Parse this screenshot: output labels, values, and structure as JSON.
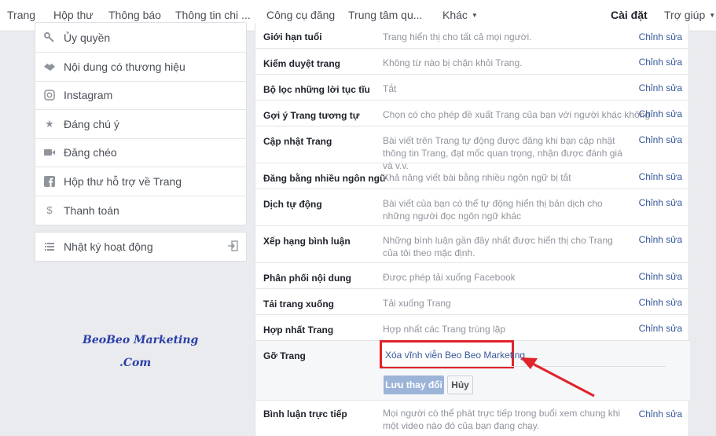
{
  "topnav": {
    "items": [
      "Trang",
      "Hộp thư",
      "Thông báo",
      "Thông tin chi ...",
      "Công cụ đăng",
      "Trung tâm qu...",
      "Khác"
    ],
    "settings": "Cài đặt",
    "help": "Trợ giúp"
  },
  "sidebar": {
    "items": [
      {
        "label": "Ủy quyền",
        "icon": "key-icon"
      },
      {
        "label": "Nội dung có thương hiệu",
        "icon": "handshake-icon"
      },
      {
        "label": "Instagram",
        "icon": "instagram-icon"
      },
      {
        "label": "Đáng chú ý",
        "icon": "star-icon"
      },
      {
        "label": "Đăng chéo",
        "icon": "video-camera-icon"
      },
      {
        "label": "Hộp thư hỗ trợ về Trang",
        "icon": "facebook-icon"
      },
      {
        "label": "Thanh toán",
        "icon": "dollar-icon"
      }
    ],
    "log": {
      "label": "Nhật ký hoạt động",
      "icon": "list-icon"
    }
  },
  "watermark": {
    "line1": "BeoBeo Marketing",
    "line2": ".Com"
  },
  "settings": {
    "rows": [
      {
        "name": "Giới hạn tuổi",
        "desc": "Trang hiển thị cho tất cả mọi người.",
        "edit": "Chỉnh sửa"
      },
      {
        "name": "Kiểm duyệt trang",
        "desc": "Không từ nào bị chặn khỏi Trang.",
        "edit": "Chỉnh sửa"
      },
      {
        "name": "Bộ lọc những lời tục tĩu",
        "desc": "Tắt",
        "edit": "Chỉnh sửa"
      },
      {
        "name": "Gợi ý Trang tương tự",
        "desc": "Chọn có cho phép đề xuất Trang của bạn với người khác không",
        "edit": "Chỉnh sửa"
      },
      {
        "name": "Cập nhật Trang",
        "desc": "Bài viết trên Trang tự động được đăng khi bạn cập nhật thông tin Trang, đạt mốc quan trọng, nhận được đánh giá và v.v.",
        "edit": "Chỉnh sửa"
      },
      {
        "name": "Đăng bằng nhiều ngôn ngữ",
        "desc": "Khả năng viết bài bằng nhiều ngôn ngữ bị tắt",
        "edit": "Chỉnh sửa"
      },
      {
        "name": "Dịch tự động",
        "desc": "Bài viết của bạn có thể tự động hiển thị bản dịch cho những người đọc ngôn ngữ khác",
        "edit": "Chỉnh sửa"
      },
      {
        "name": "Xếp hạng bình luận",
        "desc": "Những bình luận gần đây nhất được hiển thị cho Trang của tôi theo mặc định.",
        "edit": "Chỉnh sửa"
      },
      {
        "name": "Phân phối nội dung",
        "desc": "Được phép tải xuống Facebook",
        "edit": "Chỉnh sửa"
      },
      {
        "name": "Tải trang xuống",
        "desc": "Tải xuống Trang",
        "edit": "Chỉnh sửa"
      },
      {
        "name": "Hợp nhất Trang",
        "desc": "Hợp nhất các Trang trùng lặp",
        "edit": "Chỉnh sửa"
      }
    ],
    "remove": {
      "name": "Gỡ Trang",
      "link": "Xóa vĩnh viễn Beo Beo Marketing",
      "save": "Lưu thay đổi",
      "cancel": "Hủy"
    },
    "live": {
      "name": "Bình luận trực tiếp",
      "desc": "Mọi người có thể phát trực tiếp trong buổi xem chung khi một video nào đó của bạn đang chạy.",
      "edit": "Chỉnh sửa"
    }
  },
  "colors": {
    "accent": "#4267b2",
    "link": "#365899",
    "highlight": "#e0242a"
  }
}
